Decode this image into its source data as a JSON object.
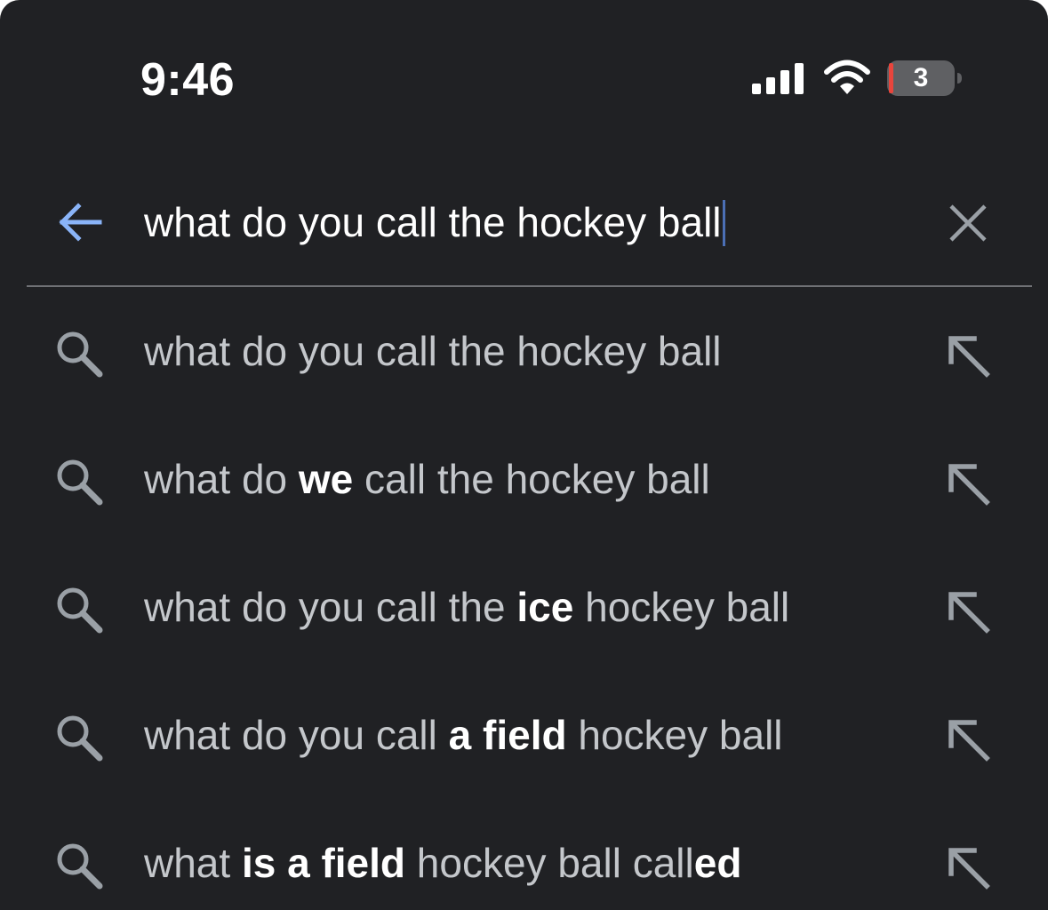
{
  "status_bar": {
    "time": "9:46",
    "battery_level": "3",
    "icons": [
      "signal-icon",
      "wifi-icon",
      "battery-icon"
    ]
  },
  "search": {
    "query": "what do you call the hockey ball",
    "back_icon": "arrow-left-icon",
    "clear_icon": "close-icon"
  },
  "suggestions": [
    {
      "parts": [
        {
          "text": "what do you call the hockey ball",
          "bold": false
        }
      ]
    },
    {
      "parts": [
        {
          "text": "what do ",
          "bold": false
        },
        {
          "text": "we",
          "bold": true
        },
        {
          "text": " call the hockey ball",
          "bold": false
        }
      ]
    },
    {
      "parts": [
        {
          "text": "what do you call the ",
          "bold": false
        },
        {
          "text": "ice",
          "bold": true
        },
        {
          "text": " hockey ball",
          "bold": false
        }
      ]
    },
    {
      "parts": [
        {
          "text": "what do you call ",
          "bold": false
        },
        {
          "text": "a field",
          "bold": true
        },
        {
          "text": " hockey ball",
          "bold": false
        }
      ]
    },
    {
      "parts": [
        {
          "text": "what ",
          "bold": false
        },
        {
          "text": "is a field",
          "bold": true
        },
        {
          "text": " hockey ball call",
          "bold": false
        },
        {
          "text": "ed",
          "bold": true
        }
      ]
    }
  ],
  "colors": {
    "background": "#202124",
    "accent": "#8ab4f8",
    "battery_low": "#e8453c",
    "suggestion_text": "#c4c7cb",
    "icon": "#9aa0a6"
  }
}
